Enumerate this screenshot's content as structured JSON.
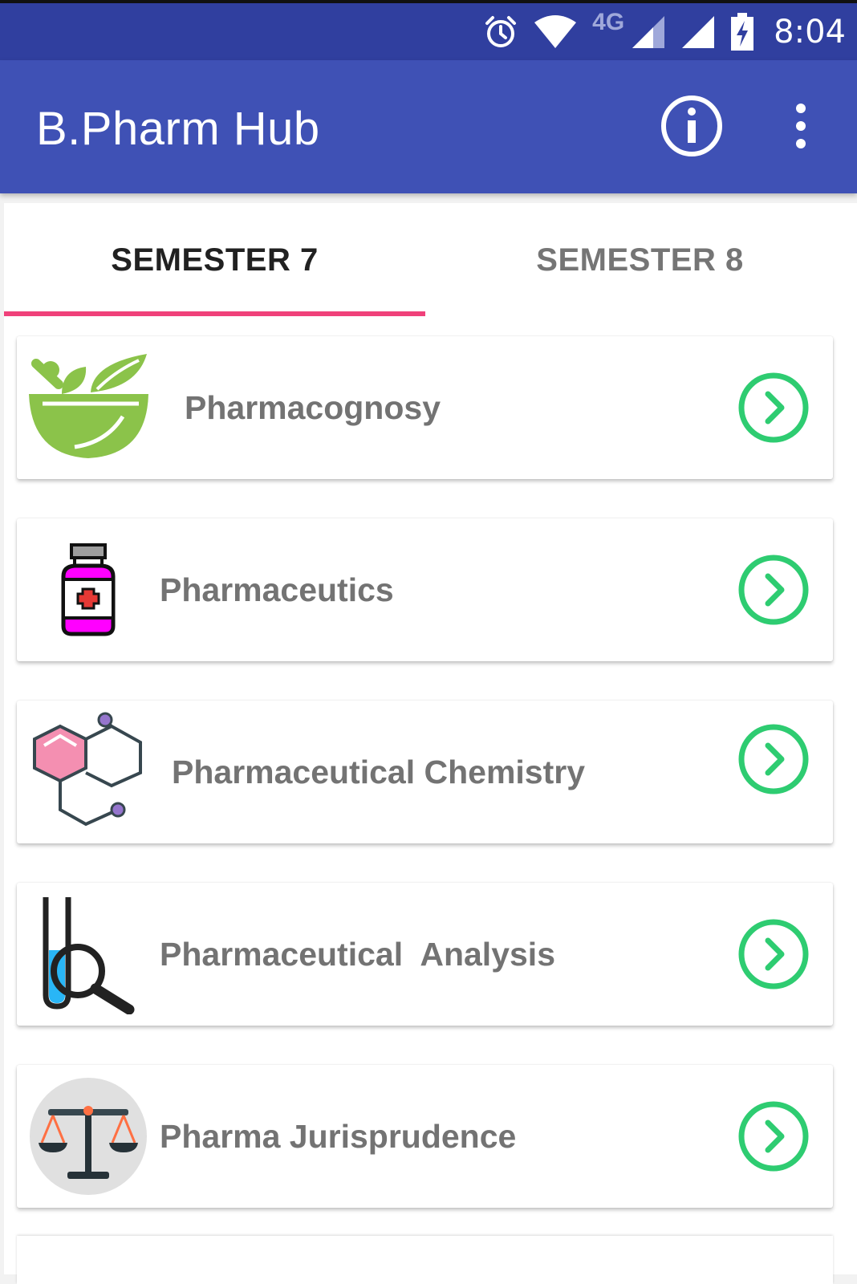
{
  "status_bar": {
    "time": "8:04",
    "network_label": "4G",
    "icons": [
      "alarm-icon",
      "wifi-icon",
      "signal-icon",
      "signal-icon",
      "battery-charging-icon"
    ]
  },
  "app_bar": {
    "title": "B.Pharm Hub",
    "actions": [
      "info-icon",
      "more-vert-icon"
    ],
    "background": "#3f51b5"
  },
  "tabs": [
    {
      "label": "SEMESTER 7",
      "selected": true
    },
    {
      "label": "SEMESTER 8",
      "selected": false
    }
  ],
  "tab_indicator_color": "#f0417a",
  "subjects": [
    {
      "label": "Pharmacognosy",
      "icon": "mortar-leaf-icon"
    },
    {
      "label": "Pharmaceutics",
      "icon": "medicine-bottle-icon"
    },
    {
      "label": "Pharmaceutical Chemistry",
      "icon": "molecule-icon"
    },
    {
      "label": "Pharmaceutical  Analysis",
      "icon": "test-tube-magnifier-icon"
    },
    {
      "label": "Pharma Jurisprudence",
      "icon": "scales-icon"
    }
  ],
  "chevron_color": "#2ecc71"
}
